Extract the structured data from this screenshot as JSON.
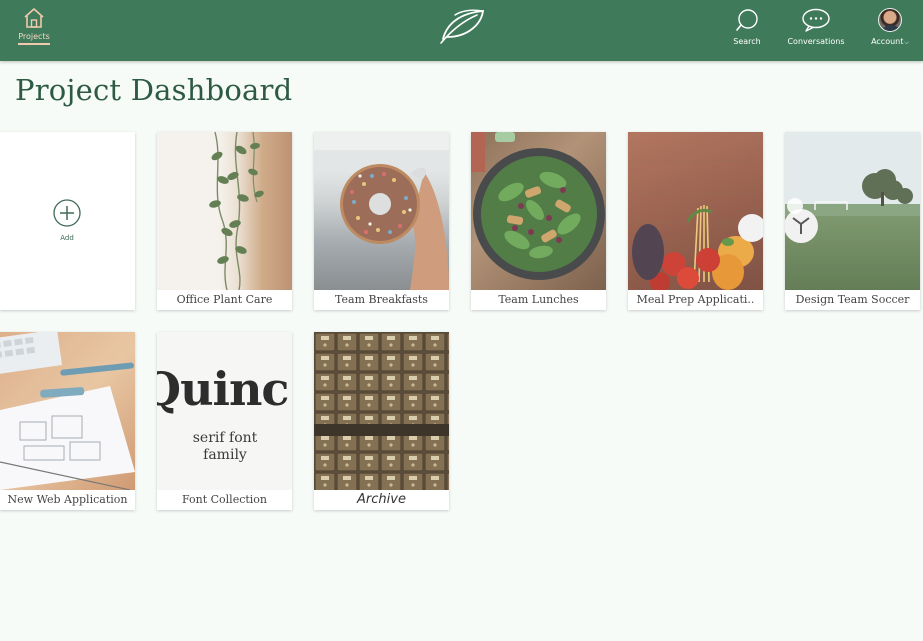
{
  "nav": {
    "projects_label": "Projects",
    "search_label": "Search",
    "conversations_label": "Conversations",
    "account_label": "Account",
    "account_caret": "⌵"
  },
  "page": {
    "title": "Project Dashboard"
  },
  "add_card": {
    "label": "Add"
  },
  "projects": [
    {
      "title": "Office Plant Care",
      "icon": "plant-photo"
    },
    {
      "title": "Team Breakfasts",
      "icon": "donut-photo"
    },
    {
      "title": "Team Lunches",
      "icon": "salad-photo"
    },
    {
      "title": "Meal Prep Applicati..",
      "icon": "vegetables-photo"
    },
    {
      "title": "Design Team Soccer",
      "icon": "soccer-field-photo"
    },
    {
      "title": "New Web Application",
      "icon": "wireframe-sketch-photo"
    },
    {
      "title": "Font Collection",
      "icon": "font-sample",
      "sample_word": "Quinc",
      "sample_caption": "serif font family"
    },
    {
      "title": "Archive",
      "icon": "card-catalog-photo"
    }
  ],
  "colors": {
    "header": "#3f7a5a",
    "title": "#2e5a44",
    "background": "#f6fbf7",
    "active_nav": "#f2c9ae"
  }
}
